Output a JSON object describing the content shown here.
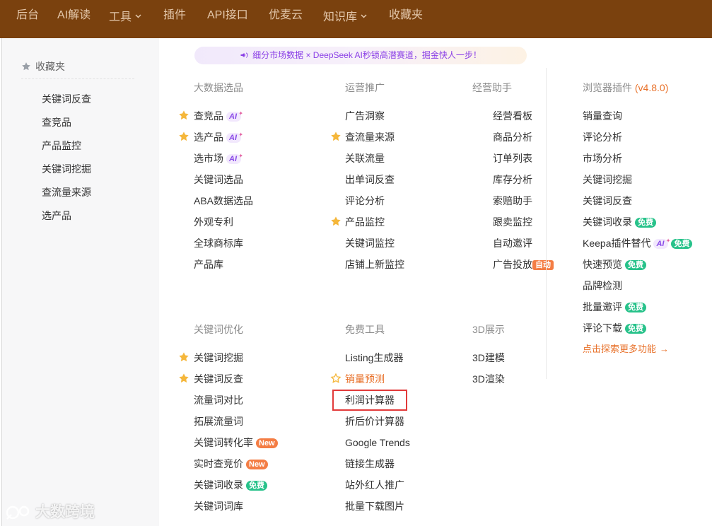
{
  "topnav": {
    "items": [
      "后台",
      "AI解读",
      "工具",
      "插件",
      "API接口",
      "优麦云",
      "知识库",
      "收藏夹"
    ],
    "caret": "⌄"
  },
  "favorites": {
    "title": "收藏夹",
    "items": [
      "关键词反查",
      "查竞品",
      "产品监控",
      "关键词挖掘",
      "查流量来源",
      "选产品"
    ]
  },
  "banner": {
    "text": "细分市场数据 × DeepSeek AI秒锁高潜赛道，掘金快人一步！"
  },
  "badges": {
    "ai": "AI",
    "new": "New",
    "free": "免费",
    "auto": "自动"
  },
  "sections": {
    "big_data": {
      "title": "大数据选品",
      "items": [
        "查竞品",
        "选产品",
        "选市场",
        "关键词选品",
        "ABA数据选品",
        "外观专利",
        "全球商标库",
        "产品库"
      ]
    },
    "ops": {
      "title": "运营推广",
      "items": [
        "广告洞察",
        "查流量来源",
        "关联流量",
        "出单词反查",
        "评论分析",
        "产品监控",
        "关键词监控",
        "店铺上新监控"
      ]
    },
    "manage": {
      "title": "经营助手",
      "items": [
        "经营看板",
        "商品分析",
        "订单列表",
        "库存分析",
        "索赔助手",
        "跟卖监控",
        "自动邀评",
        "广告投放"
      ]
    },
    "browser": {
      "title": "浏览器插件",
      "version": "(v4.8.0)",
      "items": [
        "销量查询",
        "评论分析",
        "市场分析",
        "关键词挖掘",
        "关键词反查",
        "关键词收录",
        "Keepa插件替代",
        "快速预览",
        "品牌检测",
        "批量邀评",
        "评论下载"
      ],
      "more": "点击探索更多功能",
      "more_arrow": "→"
    },
    "keyword_opt": {
      "title": "关键词优化",
      "items": [
        "关键词挖掘",
        "关键词反查",
        "流量词对比",
        "拓展流量词",
        "关键词转化率",
        "实时查竞价",
        "关键词收录",
        "关键词词库"
      ]
    },
    "free_tools": {
      "title": "免费工具",
      "items": [
        "Listing生成器",
        "销量预测",
        "利润计算器",
        "折后价计算器",
        "Google Trends",
        "链接生成器",
        "站外红人推广",
        "批量下载图片"
      ]
    },
    "three_d": {
      "title": "3D展示",
      "items": [
        "3D建模",
        "3D渲染"
      ]
    }
  },
  "watermark": {
    "text": "大数跨境"
  },
  "colors": {
    "nav_bg": "#7a410e",
    "accent": "#e8712a",
    "star": "#f5b73b",
    "free_badge": "#27c28a",
    "new_badge": "#f47d44",
    "highlight": "#e23a3a"
  }
}
